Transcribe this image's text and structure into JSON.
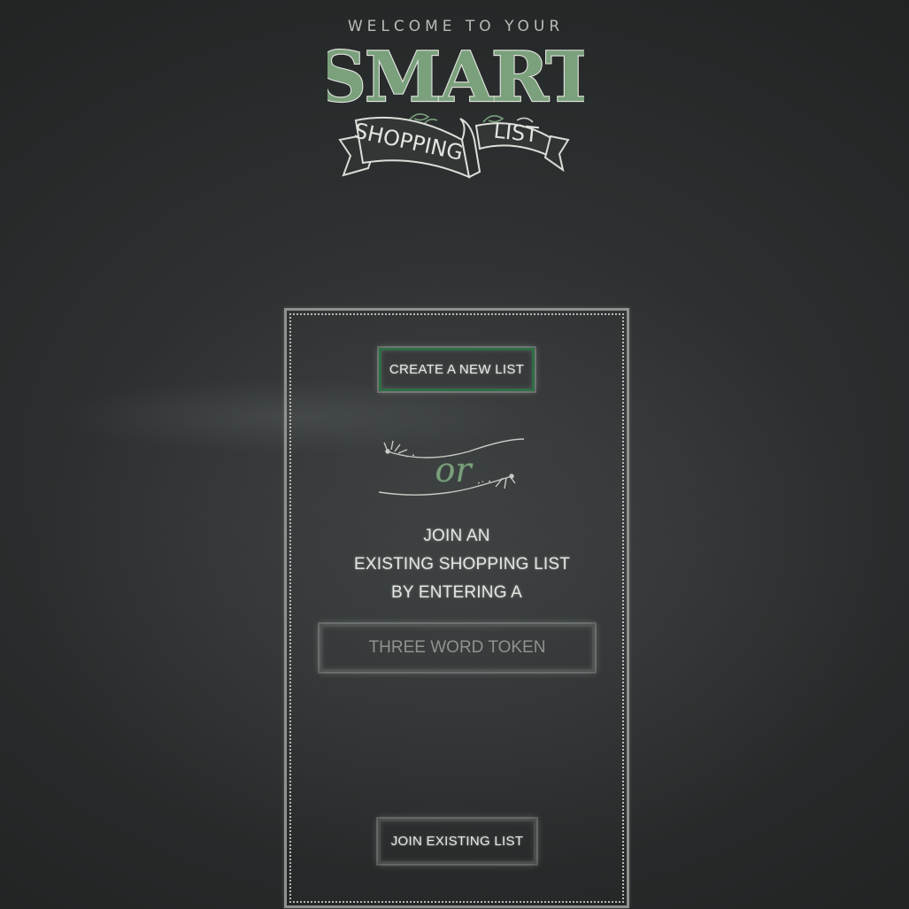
{
  "logo": {
    "welcome": "WELCOME TO YOUR",
    "smart": "SMART",
    "shopping": "SHOPPING",
    "list": "LIST"
  },
  "panel": {
    "create_button": "CREATE A NEW LIST",
    "or_word": "or",
    "join_lines": [
      "JOIN AN",
      "EXISTING SHOPPING LIST",
      "BY ENTERING A"
    ],
    "token_placeholder": "THREE WORD TOKEN",
    "join_button": "JOIN EXISTING LIST"
  },
  "colors": {
    "accent_green": "#7aa07c",
    "chalk_white": "#e3e5e0",
    "board": "#2b2e2e"
  }
}
